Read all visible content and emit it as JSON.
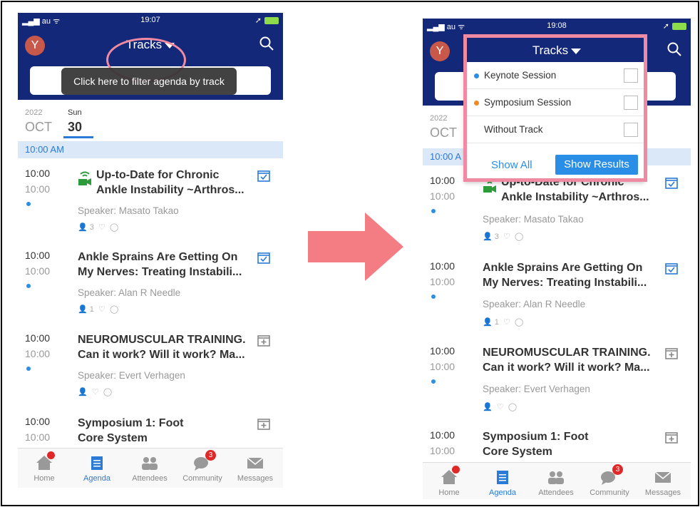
{
  "left": {
    "status": {
      "carrier": "au",
      "time": "19:07"
    },
    "avatar": "Y",
    "title": "Tracks",
    "tooltip": "Click here to filter agenda by track",
    "date": {
      "year": "2022",
      "month": "OCT",
      "dow": "Sun",
      "day": "30"
    },
    "timebar": "10:00 AM",
    "sessions": [
      {
        "start": "10:00",
        "end": "10:00",
        "title1": "Up-to-Date for Chronic",
        "title2": "Ankle Instability ~Arthros...",
        "speaker": "Speaker: Masato Takao",
        "likes": "3",
        "icon": "calendar-check-icon"
      },
      {
        "start": "10:00",
        "end": "10:00",
        "title1": "Ankle Sprains Are Getting On",
        "title2": "My Nerves: Treating Instabili...",
        "speaker": "Speaker: Alan R Needle",
        "likes": "1",
        "icon": "calendar-check-icon"
      },
      {
        "start": "10:00",
        "end": "10:00",
        "title1": "NEUROMUSCULAR TRAINING.",
        "title2": "Can it work? Will it work? Ma...",
        "speaker": "Speaker: Evert Verhagen",
        "likes": "",
        "icon": "calendar-add-icon"
      },
      {
        "start": "10:00",
        "end": "10:00",
        "title1": "Symposium 1: Foot",
        "title2": "Core System",
        "speaker": "",
        "likes": "",
        "icon": "calendar-add-icon"
      }
    ],
    "tabs": [
      "Home",
      "Agenda",
      "Attendees",
      "Community",
      "Messages"
    ],
    "community_badge": "3"
  },
  "right": {
    "status": {
      "carrier": "au",
      "time": "19:08"
    },
    "avatar": "Y",
    "title": "Tracks",
    "date": {
      "year": "2022",
      "month": "OCT"
    },
    "timebar": "10:00 A",
    "dropdown": {
      "options": [
        {
          "label": "Keynote Session",
          "color": "#2a8ee6"
        },
        {
          "label": "Symposium Session",
          "color": "#f08a24"
        },
        {
          "label": "Without Track",
          "color": ""
        }
      ],
      "show_all": "Show All",
      "show_results": "Show Results"
    },
    "sessions": [
      {
        "start": "10:00",
        "end": "10:00",
        "title1": "Up-to-Date for Chronic",
        "title2": "Ankle Instability ~Arthros...",
        "speaker": "Speaker: Masato Takao",
        "likes": "3"
      },
      {
        "start": "10:00",
        "end": "10:00",
        "title1": "Ankle Sprains Are Getting On",
        "title2": "My Nerves: Treating Instabili...",
        "speaker": "Speaker: Alan R Needle",
        "likes": "1"
      },
      {
        "start": "10:00",
        "end": "10:00",
        "title1": "NEUROMUSCULAR TRAINING.",
        "title2": "Can it work? Will it work? Ma...",
        "speaker": "Speaker: Evert Verhagen",
        "likes": ""
      },
      {
        "start": "10:00",
        "end": "10:00",
        "title1": "Symposium 1: Foot",
        "title2": "Core System",
        "speaker": "",
        "likes": ""
      }
    ],
    "tabs": [
      "Home",
      "Agenda",
      "Attendees",
      "Community",
      "Messages"
    ],
    "community_badge": "3"
  },
  "colors": {
    "navy": "#14287a",
    "accent": "#2a7ad6",
    "highlight": "#ef8aa2"
  }
}
